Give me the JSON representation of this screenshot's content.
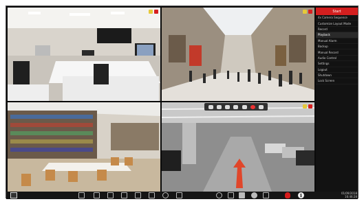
{
  "menu": {
    "header": "Start",
    "items": [
      {
        "label": "4x Camera Sequence",
        "active": false
      },
      {
        "label": "Customize Layout Mode",
        "active": false
      },
      {
        "label": "Record",
        "active": false
      },
      {
        "label": "Playback",
        "active": true
      },
      {
        "label": "Manual Alarm",
        "active": false
      },
      {
        "label": "Backup",
        "active": false
      },
      {
        "label": "Manual Record",
        "active": false
      },
      {
        "label": "Audio Control",
        "active": false
      },
      {
        "label": "Settings",
        "active": false
      },
      {
        "label": "Logout",
        "active": false
      },
      {
        "label": "Shutdown",
        "active": false
      },
      {
        "label": "Lock Screen",
        "active": false
      }
    ]
  },
  "cameras": [
    {
      "scene": "office-interior"
    },
    {
      "scene": "shopping-mall"
    },
    {
      "scene": "library"
    },
    {
      "scene": "parking-garage"
    }
  ],
  "bottom_bar": {
    "icons": [
      "start-icon",
      "single-view-icon",
      "quad-view-icon",
      "nine-view-icon",
      "sixteen-view-icon",
      "grid-view-icon",
      "sequence-icon",
      "refresh-icon",
      "screenshot-icon",
      "playback-icon",
      "volume-icon",
      "ptz-icon",
      "user-icon",
      "network-icon",
      "record-icon",
      "info-icon"
    ],
    "clock_date": "01/09/2018",
    "clock_time": "16:46:28"
  },
  "colors": {
    "accent": "#d31f1f",
    "alert_yellow": "#e6c93a"
  }
}
